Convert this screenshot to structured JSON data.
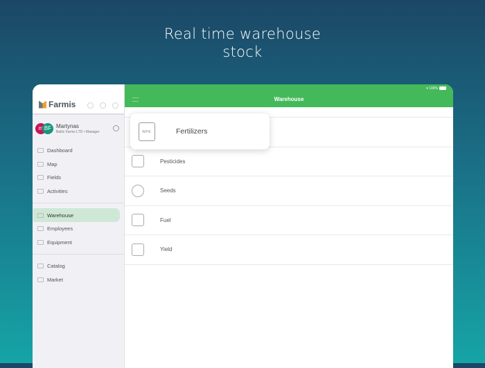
{
  "headline": {
    "line1": "Real time warehouse",
    "line2": "stock"
  },
  "status": {
    "battery": "100%"
  },
  "app": {
    "logo": "Farmis",
    "title": "Warehouse"
  },
  "user": {
    "initials1": "m",
    "initials2": "BF",
    "name": "Martynas",
    "role": "Baltic Farms LTD • Manager"
  },
  "nav": {
    "group1": [
      {
        "label": "Dashboard",
        "icon": "home-icon"
      },
      {
        "label": "Map",
        "icon": "map-icon"
      },
      {
        "label": "Fields",
        "icon": "fields-icon"
      },
      {
        "label": "Activities",
        "icon": "activities-icon"
      }
    ],
    "group2": [
      {
        "label": "Warehouse",
        "icon": "warehouse-icon",
        "active": true
      },
      {
        "label": "Employees",
        "icon": "employees-icon"
      },
      {
        "label": "Equipment",
        "icon": "equipment-icon"
      }
    ],
    "group3": [
      {
        "label": "Catalog",
        "icon": "catalog-icon"
      },
      {
        "label": "Market",
        "icon": "market-icon"
      }
    ]
  },
  "categories": [
    {
      "label": "Fertilizers",
      "icon_text": "NPK"
    },
    {
      "label": "Pesticides"
    },
    {
      "label": "Seeds"
    },
    {
      "label": "Fuel"
    },
    {
      "label": "Yield"
    }
  ],
  "colors": {
    "accent": "#44b95a",
    "active_nav": "#cfe8d6"
  }
}
